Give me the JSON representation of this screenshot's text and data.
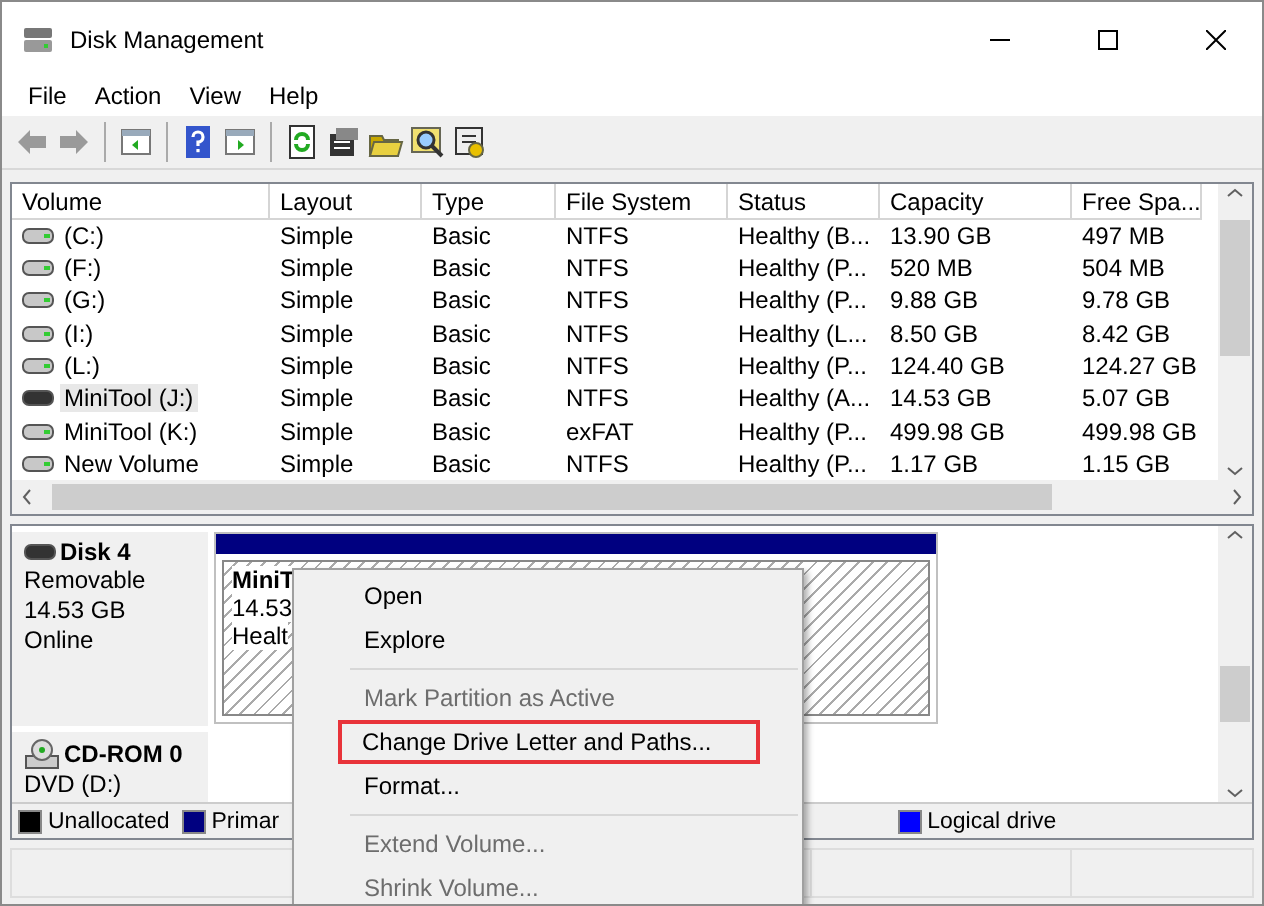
{
  "window": {
    "title": "Disk Management"
  },
  "menu": [
    "File",
    "Action",
    "View",
    "Help"
  ],
  "table": {
    "columns": [
      "Volume",
      "Layout",
      "Type",
      "File System",
      "Status",
      "Capacity",
      "Free Spa..."
    ],
    "rows": [
      {
        "kind": "fixed",
        "selected": false,
        "cells": [
          "(C:)",
          "Simple",
          "Basic",
          "NTFS",
          "Healthy (B...",
          "13.90 GB",
          "497 MB"
        ]
      },
      {
        "kind": "fixed",
        "selected": false,
        "cells": [
          "(F:)",
          "Simple",
          "Basic",
          "NTFS",
          "Healthy (P...",
          "520 MB",
          "504 MB"
        ]
      },
      {
        "kind": "fixed",
        "selected": false,
        "cells": [
          "(G:)",
          "Simple",
          "Basic",
          "NTFS",
          "Healthy (P...",
          "9.88 GB",
          "9.78 GB"
        ]
      },
      {
        "kind": "fixed",
        "selected": false,
        "cells": [
          "(I:)",
          "Simple",
          "Basic",
          "NTFS",
          "Healthy (L...",
          "8.50 GB",
          "8.42 GB"
        ]
      },
      {
        "kind": "fixed",
        "selected": false,
        "cells": [
          "(L:)",
          "Simple",
          "Basic",
          "NTFS",
          "Healthy (P...",
          "124.40 GB",
          "124.27 GB"
        ]
      },
      {
        "kind": "removable",
        "selected": true,
        "cells": [
          "MiniTool (J:)",
          "Simple",
          "Basic",
          "NTFS",
          "Healthy (A...",
          "14.53 GB",
          "5.07 GB"
        ]
      },
      {
        "kind": "fixed",
        "selected": false,
        "cells": [
          "MiniTool (K:)",
          "Simple",
          "Basic",
          "exFAT",
          "Healthy (P...",
          "499.98 GB",
          "499.98 GB"
        ]
      },
      {
        "kind": "fixed",
        "selected": false,
        "cells": [
          "New Volume",
          "Simple",
          "Basic",
          "NTFS",
          "Healthy (P...",
          "1.17 GB",
          "1.15 GB"
        ]
      }
    ]
  },
  "disks": [
    {
      "kind": "removable",
      "name": "Disk 4",
      "lines": [
        "Removable",
        "14.53 GB",
        "Online"
      ],
      "partition": {
        "name": "MiniT",
        "size": "14.53",
        "status": "Healt"
      }
    },
    {
      "kind": "cdrom",
      "name": "CD-ROM 0",
      "lines": [
        "DVD (D:)"
      ]
    }
  ],
  "legend": [
    {
      "label": "Unallocated",
      "color": "#000000"
    },
    {
      "label": "Primar",
      "color": "#000080"
    },
    {
      "label": "Logical drive",
      "color": "#0000ff"
    }
  ],
  "context_menu": [
    {
      "kind": "item",
      "label": "Open",
      "disabled": false,
      "outlined": false
    },
    {
      "kind": "item",
      "label": "Explore",
      "disabled": false,
      "outlined": false
    },
    {
      "kind": "separator"
    },
    {
      "kind": "item",
      "label": "Mark Partition as Active",
      "disabled": true,
      "outlined": false
    },
    {
      "kind": "item",
      "label": "Change Drive Letter and Paths...",
      "disabled": false,
      "outlined": true
    },
    {
      "kind": "item",
      "label": "Format...",
      "disabled": false,
      "outlined": false
    },
    {
      "kind": "separator"
    },
    {
      "kind": "item",
      "label": "Extend Volume...",
      "disabled": true,
      "outlined": false
    },
    {
      "kind": "item",
      "label": "Shrink Volume...",
      "disabled": true,
      "outlined": false
    }
  ]
}
